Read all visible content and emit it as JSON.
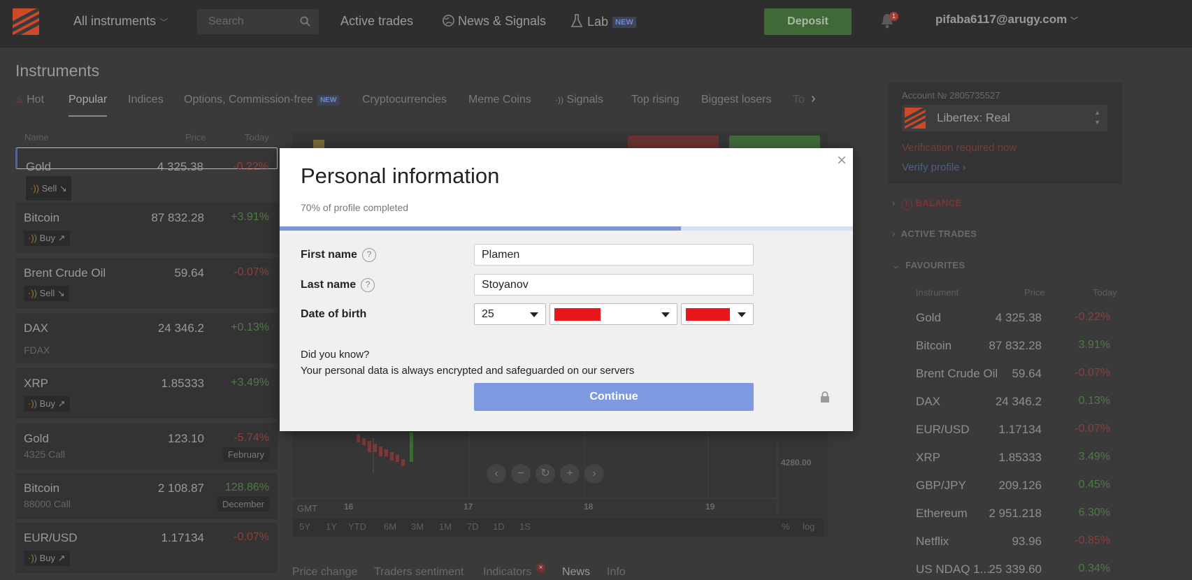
{
  "topbar": {
    "instruments_menu": "All instruments",
    "search_placeholder": "Search",
    "active_trades": "Active trades",
    "news_signals": "News & Signals",
    "lab": "Lab",
    "lab_badge": "NEW",
    "deposit": "Deposit",
    "notifications_count": "1",
    "user_email": "pifaba6117@arugy.com"
  },
  "instruments": {
    "title": "Instruments",
    "tabs": [
      {
        "label": "Hot"
      },
      {
        "label": "Popular",
        "active": true
      },
      {
        "label": "Indices"
      },
      {
        "label": "Options, Commission-free",
        "badge": "NEW"
      },
      {
        "label": "Cryptocurrencies"
      },
      {
        "label": "Meme Coins"
      },
      {
        "label": "Signals"
      },
      {
        "label": "Top rising"
      },
      {
        "label": "Biggest losers"
      },
      {
        "label": "To"
      }
    ],
    "columns": {
      "name": "Name",
      "price": "Price",
      "today": "Today"
    },
    "rows": [
      {
        "name": "Gold",
        "price": "4 325.38",
        "change": "-0.22%",
        "tag": "Sell ↘"
      },
      {
        "name": "Bitcoin",
        "price": "87 832.28",
        "change": "+3.91%",
        "tag": "Buy ↗"
      },
      {
        "name": "Brent Crude Oil",
        "price": "59.64",
        "change": "-0.07%",
        "tag": "Sell ↘"
      },
      {
        "name": "DAX",
        "price": "24 346.2",
        "change": "+0.13%",
        "sub": "FDAX"
      },
      {
        "name": "XRP",
        "price": "1.85333",
        "change": "+3.49%",
        "tag": "Buy ↗"
      },
      {
        "name": "Gold",
        "price": "123.10",
        "change": "-5.74%",
        "sub": "4325 Call",
        "month": "February"
      },
      {
        "name": "Bitcoin",
        "price": "2 108.87",
        "change": "128.86%",
        "sub": "88000 Call",
        "month": "December"
      },
      {
        "name": "EUR/USD",
        "price": "1.17134",
        "change": "-0.07%",
        "tag": "Buy ↗"
      }
    ]
  },
  "chart": {
    "x_ticks": [
      "16",
      "17",
      "18",
      "19"
    ],
    "y_tick": "4280.00",
    "timezone": "GMT",
    "periods": [
      "5Y",
      "1Y",
      "YTD",
      "6M",
      "3M",
      "1M",
      "7D",
      "1D",
      "1S"
    ],
    "scale_options": [
      "%",
      "log"
    ],
    "nav": [
      "‹",
      "−",
      "↻",
      "+",
      "›"
    ]
  },
  "bottom_tabs": [
    "Price change",
    "Traders sentiment",
    "Indicators",
    "News",
    "Info"
  ],
  "indicators_badge": "×",
  "account": {
    "number_label": "Account № 2805735527",
    "account_name": "Libertex: Real",
    "verification_warning": "Verification required now",
    "verify_link": "Verify profile ›"
  },
  "sidebar_sections": {
    "balance": "BALANCE",
    "active_trades": "ACTIVE TRADES",
    "favourites": "FAVOURITES"
  },
  "favourites": {
    "columns": {
      "instrument": "Instrument",
      "price": "Price",
      "today": "Today"
    },
    "rows": [
      {
        "name": "Gold",
        "price": "4 325.38",
        "change": "-0.22%"
      },
      {
        "name": "Bitcoin",
        "price": "87 832.28",
        "change": "3.91%"
      },
      {
        "name": "Brent Crude Oil",
        "price": "59.64",
        "change": "-0.07%"
      },
      {
        "name": "DAX",
        "price": "24 346.2",
        "change": "0.13%"
      },
      {
        "name": "EUR/USD",
        "price": "1.17134",
        "change": "-0.07%"
      },
      {
        "name": "XRP",
        "price": "1.85333",
        "change": "3.49%"
      },
      {
        "name": "GBP/JPY",
        "price": "209.126",
        "change": "0.45%"
      },
      {
        "name": "Ethereum",
        "price": "2 951.218",
        "change": "6.30%"
      },
      {
        "name": "Netflix",
        "price": "93.96",
        "change": "-0.85%"
      },
      {
        "name": "US NDAQ 1...",
        "price": "25 339.60",
        "change": "0.34%"
      }
    ]
  },
  "modal": {
    "title": "Personal information",
    "progress_text": "70% of profile completed",
    "progress_fraction": 0.7,
    "first_name_label": "First name",
    "first_name_value": "Plamen",
    "last_name_label": "Last name",
    "last_name_value": "Stoyanov",
    "dob_label": "Date of birth",
    "dob_day": "25",
    "did_you_know": "Did you know?",
    "security_note": "Your personal data is always encrypted and safeguarded on our servers",
    "continue": "Continue",
    "help_glyph": "?",
    "close_glyph": "×"
  },
  "colors": {
    "accent": "#7f99e0",
    "negative": "#8c3f3f",
    "positive": "#4d7c45",
    "deposit": "#3f6a38",
    "redaction": "#e8171c"
  }
}
